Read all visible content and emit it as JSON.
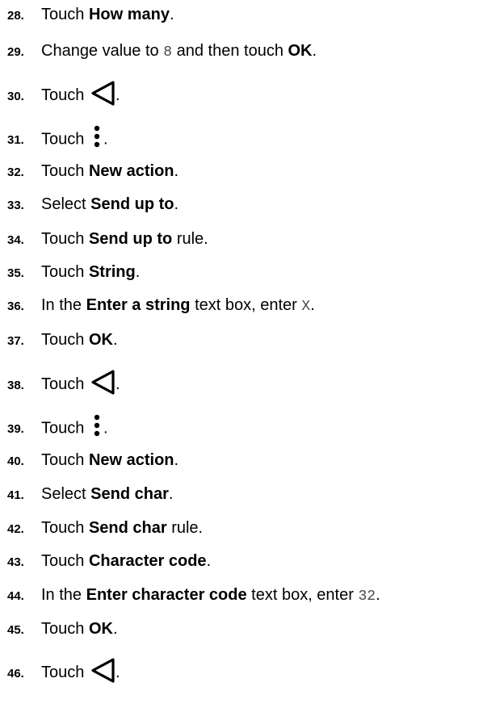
{
  "steps": [
    {
      "num": "28.",
      "pre": "Touch ",
      "bold": "How many",
      "post": "."
    },
    {
      "num": "29.",
      "pre": "Change value to ",
      "code": "8",
      "mid": " and then touch ",
      "bold": "OK",
      "post": "."
    },
    {
      "num": "30.",
      "pre": "Touch ",
      "icon": "back-triangle-icon",
      "post": "."
    },
    {
      "num": "31.",
      "pre": "Touch ",
      "icon": "more-vertical-icon",
      "post": "."
    },
    {
      "num": "32.",
      "pre": "Touch ",
      "bold": "New action",
      "post": "."
    },
    {
      "num": "33.",
      "pre": "Select ",
      "bold": "Send up to",
      "post": "."
    },
    {
      "num": "34.",
      "pre": "Touch ",
      "bold": "Send up to",
      "post": " rule."
    },
    {
      "num": "35.",
      "pre": "Touch ",
      "bold": "String",
      "post": "."
    },
    {
      "num": "36.",
      "pre": "In the ",
      "bold": "Enter a string",
      "mid": " text box, enter ",
      "code": "X",
      "post": "."
    },
    {
      "num": "37.",
      "pre": "Touch ",
      "bold": "OK",
      "post": "."
    },
    {
      "num": "38.",
      "pre": "Touch ",
      "icon": "back-triangle-icon",
      "post": "."
    },
    {
      "num": "39.",
      "pre": "Touch ",
      "icon": "more-vertical-icon",
      "post": "."
    },
    {
      "num": "40.",
      "pre": "Touch ",
      "bold": "New action",
      "post": "."
    },
    {
      "num": "41.",
      "pre": "Select ",
      "bold": "Send char",
      "post": "."
    },
    {
      "num": "42.",
      "pre": "Touch ",
      "bold": "Send char",
      "post": " rule."
    },
    {
      "num": "43.",
      "pre": "Touch ",
      "bold": "Character code",
      "post": "."
    },
    {
      "num": "44.",
      "pre": "In the ",
      "bold": "Enter character code",
      "mid": " text box, enter ",
      "code": "32",
      "post": "."
    },
    {
      "num": "45.",
      "pre": "Touch ",
      "bold": "OK",
      "post": "."
    },
    {
      "num": "46.",
      "pre": "Touch ",
      "icon": "back-triangle-icon",
      "post": "."
    }
  ]
}
